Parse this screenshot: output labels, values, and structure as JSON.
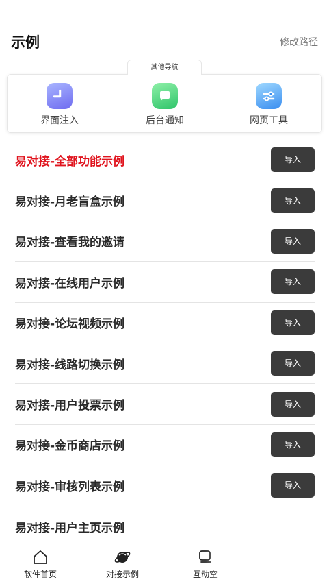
{
  "header": {
    "title": "示例",
    "edit_path": "修改路径"
  },
  "nav": {
    "tab_label": "其他导航",
    "items": [
      {
        "label": "界面注入",
        "icon": "arrow-down-icon",
        "color": "#7b79f2"
      },
      {
        "label": "后台通知",
        "icon": "chat-bubble-icon",
        "color": "#34c76f"
      },
      {
        "label": "网页工具",
        "icon": "sliders-icon",
        "color": "#3d90f0"
      }
    ]
  },
  "examples": {
    "import_label": "导入",
    "items": [
      {
        "title": "易对接-全部功能示例"
      },
      {
        "title": "易对接-月老盲盒示例"
      },
      {
        "title": "易对接-查看我的邀请"
      },
      {
        "title": "易对接-在线用户示例"
      },
      {
        "title": "易对接-论坛视频示例"
      },
      {
        "title": "易对接-线路切换示例"
      },
      {
        "title": "易对接-用户投票示例"
      },
      {
        "title": "易对接-金币商店示例"
      },
      {
        "title": "易对接-审核列表示例"
      },
      {
        "title": "易对接-用户主页示例"
      }
    ],
    "highlight_color": "#e0141e"
  },
  "tabbar": {
    "items": [
      {
        "label": "软件首页",
        "icon": "home-icon"
      },
      {
        "label": "对接示例",
        "icon": "planet-icon"
      },
      {
        "label": "互动空",
        "icon": "chat-square-icon"
      }
    ]
  }
}
